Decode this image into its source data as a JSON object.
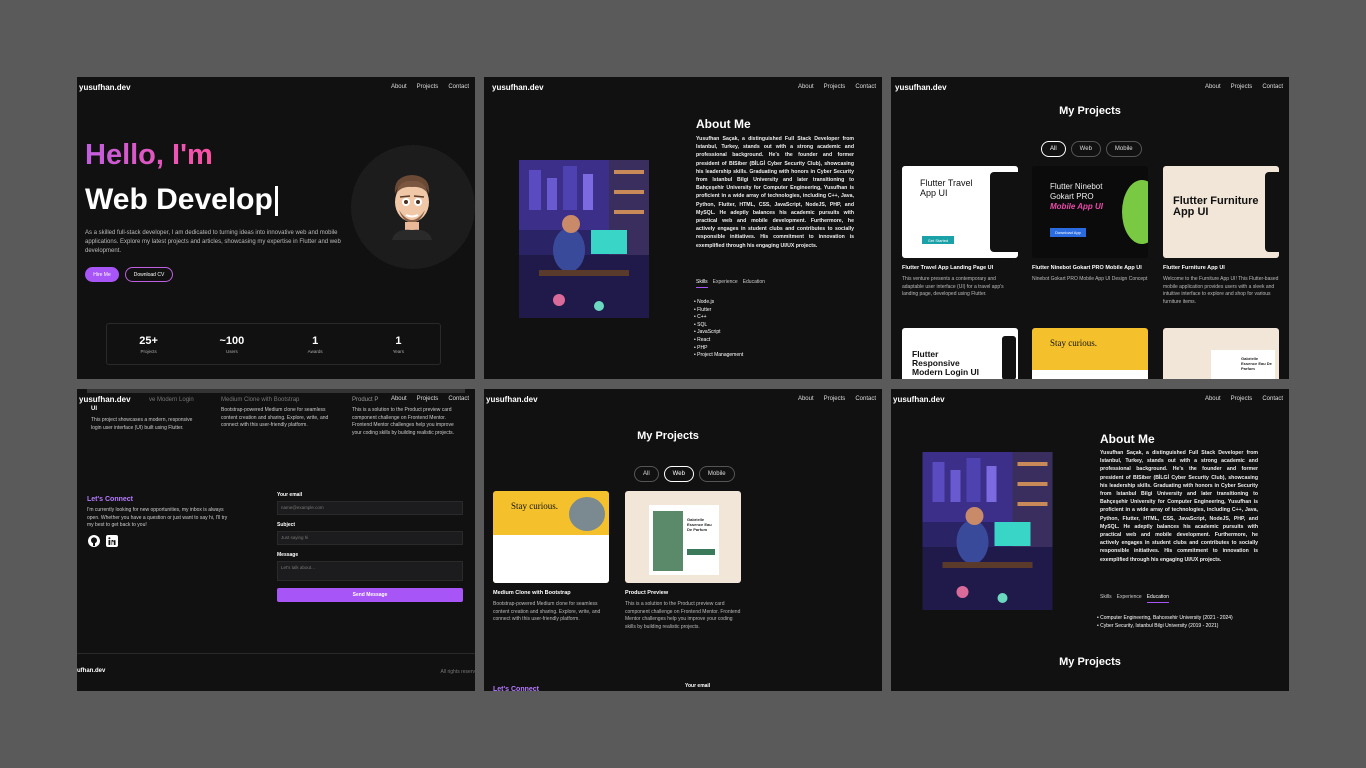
{
  "nav": {
    "logo": "yusufhan.dev",
    "about": "About",
    "projects": "Projects",
    "contact": "Contact"
  },
  "hero": {
    "hello": "Hello, I'm",
    "role": "Web Develop",
    "text": "As a skilled full-stack developer, I am dedicated to turning ideas into innovative web and mobile applications. Explore my latest projects and articles, showcasing my expertise in Flutter and web development.",
    "hire": "Hire Me",
    "cv": "Download CV",
    "stats": [
      {
        "value": "25+",
        "label": "Projects"
      },
      {
        "value": "~100",
        "label": "Users"
      },
      {
        "value": "1",
        "label": "Awards"
      },
      {
        "value": "1",
        "label": "Years"
      }
    ]
  },
  "about": {
    "title": "About Me",
    "body": "Yusufhan Saçak, a distinguished Full Stack Developer from Istanbul, Turkey, stands out with a strong academic and professional background. He's the founder and former president of BISiber (BİLGİ Cyber Security Club), showcasing his leadership skills. Graduating with honors in Cyber Security from Istanbul Bilgi University and later transitioning to Bahçeşehir University for Computer Engineering, Yusufhan is proficient in a wide array of technologies, including C++, Java, Python, Flutter, HTML, CSS, JavaScript, NodeJS, PHP, and MySQL. He adeptly balances his academic pursuits with practical web and mobile development. Furthermore, he actively engages in student clubs and contributes to socially responsible initiatives. His commitment to innovation is exemplified through his engaging UI/UX projects.",
    "tabs": [
      "Skills",
      "Experience",
      "Education"
    ],
    "skills": [
      "Node.js",
      "Flutter",
      "C++",
      "SQL",
      "JavaScript",
      "React",
      "PHP",
      "Project Management"
    ],
    "education": [
      "Computer Engineering, Bahcesehir University (2021 - 2024)",
      "Cyber Security, Istanbul Bilgi University (2019 - 2021)"
    ]
  },
  "projects": {
    "title": "My Projects",
    "filters": [
      "All",
      "Web",
      "Mobile"
    ],
    "cards": [
      {
        "thumb": "Flutter Travel App UI",
        "title": "Flutter Travel App Landing Page UI",
        "desc": "This venture presents a contemporary and adaptable user interface (UI) for a travel app's landing page, developed using Flutter.",
        "thumb_btn": "Get Started"
      },
      {
        "thumb": "Flutter Ninebot Gokart PRO",
        "thumb2": "Mobile App UI",
        "title": "Flutter Ninebot Gokart PRO Mobile App UI",
        "desc": "Ninebot Gokart PRO Mobile App UI Design Concept",
        "thumb_btn": "Download App"
      },
      {
        "thumb": "Flutter Furniture App UI",
        "title": "Flutter Furniture App UI",
        "desc": "Welcome to the Furniture App UI! This Flutter-based mobile application provides users with a sleek and intuitive interface to explore and shop for various furniture items."
      },
      {
        "thumb": "Flutter Responsive Modern Login UI"
      },
      {
        "thumb": "Stay curious."
      },
      {
        "thumb": "Gabrielle Essence Eau De Parfum"
      }
    ],
    "web_cards": [
      {
        "thumb": "Stay curious.",
        "title": "Medium Clone with Bootstrap",
        "desc": "Bootstrap-powered Medium clone for seamless content creation and sharing. Explore, write, and connect with this user-friendly platform."
      },
      {
        "thumb": "Gabrielle Essence Eau De Parfum",
        "title": "Product Preview",
        "desc": "This is a solution to the Product preview card component challenge on Frontend Mentor. Frontend Mentor challenges help you improve your coding skills by building realistic projects."
      }
    ],
    "login_desc": "This project showcases a modern, responsive login user interface (UI) built using Flutter.",
    "login_title_partial": "ve Modern Login",
    "ui_partial": "UI",
    "medium_partial": "Medium Clone with Bootstrap",
    "product_partial": "Product P"
  },
  "contact": {
    "title": "Let's Connect",
    "text": "I'm currently looking for new opportunities, my inbox is always open. Whether you have a question or just want to say hi, I'll try my best to get back to you!",
    "email_label": "Your email",
    "email_ph": "name@example.com",
    "subject_label": "Subject",
    "subject_ph": "Just saying hi",
    "message_label": "Message",
    "message_ph": "Let's talk about...",
    "send": "Send Message",
    "footer_logo": "ufhan.dev",
    "rights": "All rights reserv"
  },
  "colors": {
    "accent": "#a855f7",
    "bg": "#111111",
    "canvas": "#5a5a5a"
  }
}
